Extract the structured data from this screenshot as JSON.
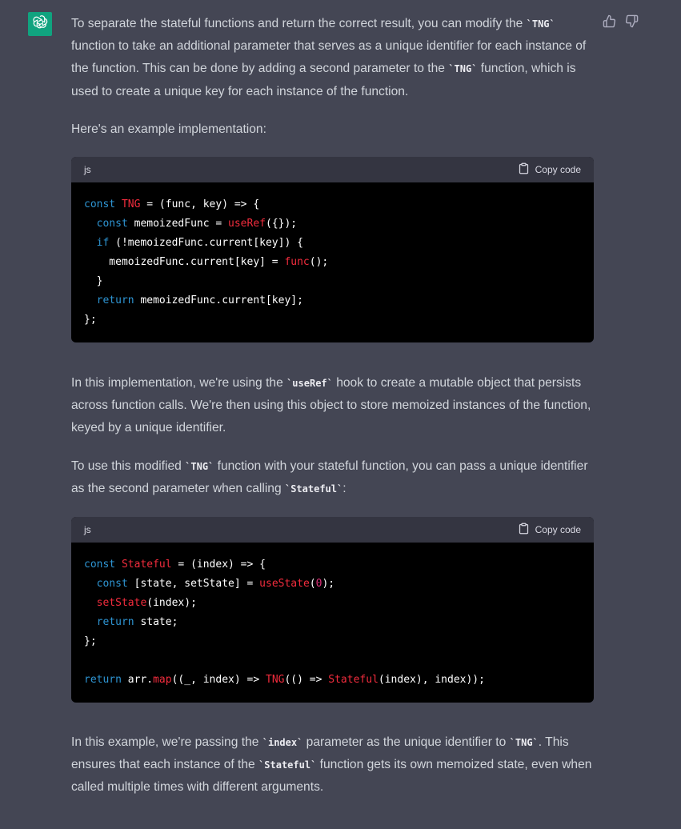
{
  "message": {
    "p1_a": "To separate the stateful functions and return the correct result, you can modify the ",
    "p1_code1": "`TNG`",
    "p1_b": " function to take an additional parameter that serves as a unique identifier for each instance of the function. This can be done by adding a second parameter to the ",
    "p1_code2": "`TNG`",
    "p1_c": " function, which is used to create a unique key for each instance of the function.",
    "p2": "Here's an example implementation:",
    "p3_a": "In this implementation, we're using the ",
    "p3_code": "`useRef`",
    "p3_b": " hook to create a mutable object that persists across function calls. We're then using this object to store memoized instances of the function, keyed by a unique identifier.",
    "p4_a": "To use this modified ",
    "p4_code1": "`TNG`",
    "p4_b": " function with your stateful function, you can pass a unique identifier as the second parameter when calling ",
    "p4_code2": "`Stateful`",
    "p4_c": ":",
    "p5_a": "In this example, we're passing the ",
    "p5_code1": "`index`",
    "p5_b": " parameter as the unique identifier to ",
    "p5_code2": "`TNG`",
    "p5_c": ". This ensures that each instance of the ",
    "p5_code3": "`Stateful`",
    "p5_d": " function gets its own memoized state, even when called multiple times with different arguments."
  },
  "code_block_1": {
    "language": "js",
    "copy_label": "Copy code",
    "lines": [
      [
        [
          "kw",
          "const "
        ],
        [
          "fn",
          "TNG"
        ],
        [
          "t",
          " = (func, key) => {"
        ]
      ],
      [
        [
          "t",
          "  "
        ],
        [
          "kw",
          "const "
        ],
        [
          "t",
          "memoizedFunc = "
        ],
        [
          "fn",
          "useRef"
        ],
        [
          "t",
          "({});"
        ]
      ],
      [
        [
          "t",
          "  "
        ],
        [
          "kw",
          "if"
        ],
        [
          "t",
          " (!memoizedFunc.current[key]) {"
        ]
      ],
      [
        [
          "t",
          "    memoizedFunc.current[key] = "
        ],
        [
          "fn",
          "func"
        ],
        [
          "t",
          "();"
        ]
      ],
      [
        [
          "t",
          "  }"
        ]
      ],
      [
        [
          "t",
          "  "
        ],
        [
          "kw",
          "return"
        ],
        [
          "t",
          " memoizedFunc.current[key];"
        ]
      ],
      [
        [
          "t",
          "};"
        ]
      ]
    ]
  },
  "code_block_2": {
    "language": "js",
    "copy_label": "Copy code",
    "lines": [
      [
        [
          "kw",
          "const "
        ],
        [
          "fn",
          "Stateful"
        ],
        [
          "t",
          " = (index) => {"
        ]
      ],
      [
        [
          "t",
          "  "
        ],
        [
          "kw",
          "const "
        ],
        [
          "t",
          "[state, setState] = "
        ],
        [
          "fn",
          "useState"
        ],
        [
          "t",
          "("
        ],
        [
          "num",
          "0"
        ],
        [
          "t",
          ");"
        ]
      ],
      [
        [
          "t",
          "  "
        ],
        [
          "fn",
          "setState"
        ],
        [
          "t",
          "(index);"
        ]
      ],
      [
        [
          "t",
          "  "
        ],
        [
          "kw",
          "return"
        ],
        [
          "t",
          " state;"
        ]
      ],
      [
        [
          "t",
          "};"
        ]
      ],
      [
        [
          "t",
          ""
        ]
      ],
      [
        [
          "kw",
          "return"
        ],
        [
          "t",
          " arr."
        ],
        [
          "fn",
          "map"
        ],
        [
          "t",
          "((_, index) => "
        ],
        [
          "fn",
          "TNG"
        ],
        [
          "t",
          "(() => "
        ],
        [
          "fn",
          "Stateful"
        ],
        [
          "t",
          "(index), index));"
        ]
      ]
    ]
  },
  "icons": {
    "avatar": "openai-logo-icon",
    "thumbs_up": "thumbs-up-icon",
    "thumbs_down": "thumbs-down-icon",
    "copy": "clipboard-icon"
  },
  "colors": {
    "background": "#444654",
    "avatar_bg": "#10a37f",
    "code_bg": "#000000",
    "code_header_bg": "#343541",
    "keyword": "#2e95d3",
    "function": "#f22c3d",
    "number": "#df3079"
  }
}
